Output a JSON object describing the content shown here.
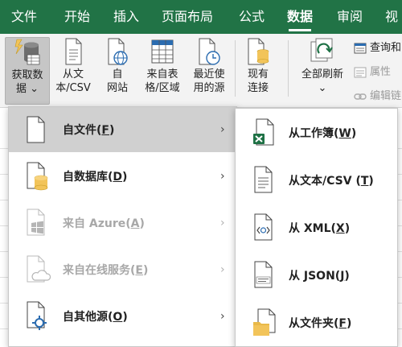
{
  "tabs": [
    {
      "label": "文件",
      "active": false
    },
    {
      "label": "开始",
      "active": false
    },
    {
      "label": "插入",
      "active": false
    },
    {
      "label": "页面布局",
      "active": false
    },
    {
      "label": "公式",
      "active": false
    },
    {
      "label": "数据",
      "active": true
    },
    {
      "label": "审阅",
      "active": false
    },
    {
      "label": "视",
      "active": false
    }
  ],
  "colors": {
    "tab_bar": "#217346",
    "ribbon_bg": "#f3f3f3",
    "excel_green": "#1e7145",
    "folder_yellow": "#f2c45a",
    "azure_gray": "#b5b5b5",
    "target_blue": "#2b6cb0"
  },
  "ribbon": {
    "get_data": {
      "line1": "获取数",
      "line2": "据",
      "icon": "database-get-icon"
    },
    "from_text_csv": {
      "line1": "从文",
      "line2": "本/CSV",
      "icon": "text-file-icon"
    },
    "from_web": {
      "line1": "自",
      "line2": "网站",
      "icon": "web-page-icon"
    },
    "from_table": {
      "line1": "来自表",
      "line2": "格/区域",
      "icon": "table-grid-icon"
    },
    "recent_sources": {
      "line1": "最近使",
      "line2": "用的源",
      "icon": "recent-clock-icon"
    },
    "existing_connections": {
      "line1": "现有",
      "line2": "连接",
      "icon": "existing-connections-icon"
    },
    "refresh_all": {
      "line1": "全部刷新",
      "icon": "refresh-icon"
    },
    "queries": {
      "label": "查询和",
      "icon": "queries-icon"
    },
    "properties": {
      "label": "属性",
      "icon": "properties-icon"
    },
    "edit_links": {
      "label": "编辑链",
      "icon": "edit-links-icon"
    }
  },
  "menu": {
    "items": [
      {
        "label": "自文件(",
        "key": "F",
        "suffix": ")",
        "icon": "file-icon",
        "disabled": false,
        "highlight": true
      },
      {
        "label": "自数据库(",
        "key": "D",
        "suffix": ")",
        "icon": "database-icon",
        "disabled": false,
        "highlight": false
      },
      {
        "label": "来自 Azure(",
        "key": "A",
        "suffix": ")",
        "icon": "azure-icon",
        "disabled": true,
        "highlight": false
      },
      {
        "label": "来自在线服务(",
        "key": "E",
        "suffix": ")",
        "icon": "online-service-icon",
        "disabled": true,
        "highlight": false
      },
      {
        "label": "自其他源(",
        "key": "O",
        "suffix": ")",
        "icon": "other-sources-icon",
        "disabled": false,
        "highlight": false
      }
    ],
    "chevron": "›"
  },
  "submenu": {
    "items": [
      {
        "label": "从工作簿(",
        "key": "W",
        "suffix": ")",
        "icon": "excel-workbook-icon"
      },
      {
        "label": "从文本/CSV (",
        "key": "T",
        "suffix": ")",
        "icon": "text-csv-icon"
      },
      {
        "label": "从 XML(",
        "key": "X",
        "suffix": ")",
        "icon": "xml-icon"
      },
      {
        "label": "从 JSON(",
        "key": "J",
        "suffix": ")",
        "icon": "json-icon"
      },
      {
        "label": "从文件夹(",
        "key": "F",
        "suffix": ")",
        "icon": "folder-icon"
      }
    ]
  }
}
